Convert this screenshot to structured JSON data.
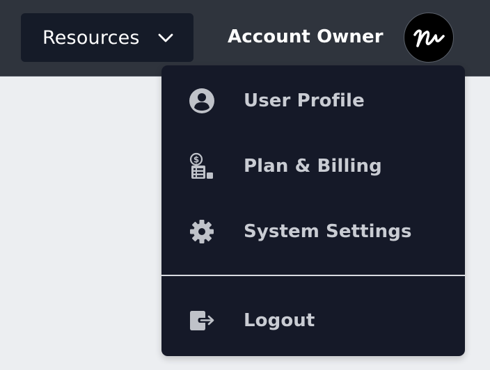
{
  "header": {
    "resources_label": "Resources",
    "account_name": "Account Owner"
  },
  "dropdown": {
    "items": [
      {
        "label": "User Profile",
        "icon": "user-circle-icon"
      },
      {
        "label": "Plan & Billing",
        "icon": "billing-icon"
      },
      {
        "label": "System Settings",
        "icon": "gear-icon"
      }
    ],
    "logout_label": "Logout",
    "logout_icon": "logout-icon"
  },
  "colors": {
    "topbar": "#2f343d",
    "button_bg": "#151b28",
    "menu_bg": "#151928",
    "menu_text": "#c9ccd3",
    "page_bg": "#eceef1"
  }
}
